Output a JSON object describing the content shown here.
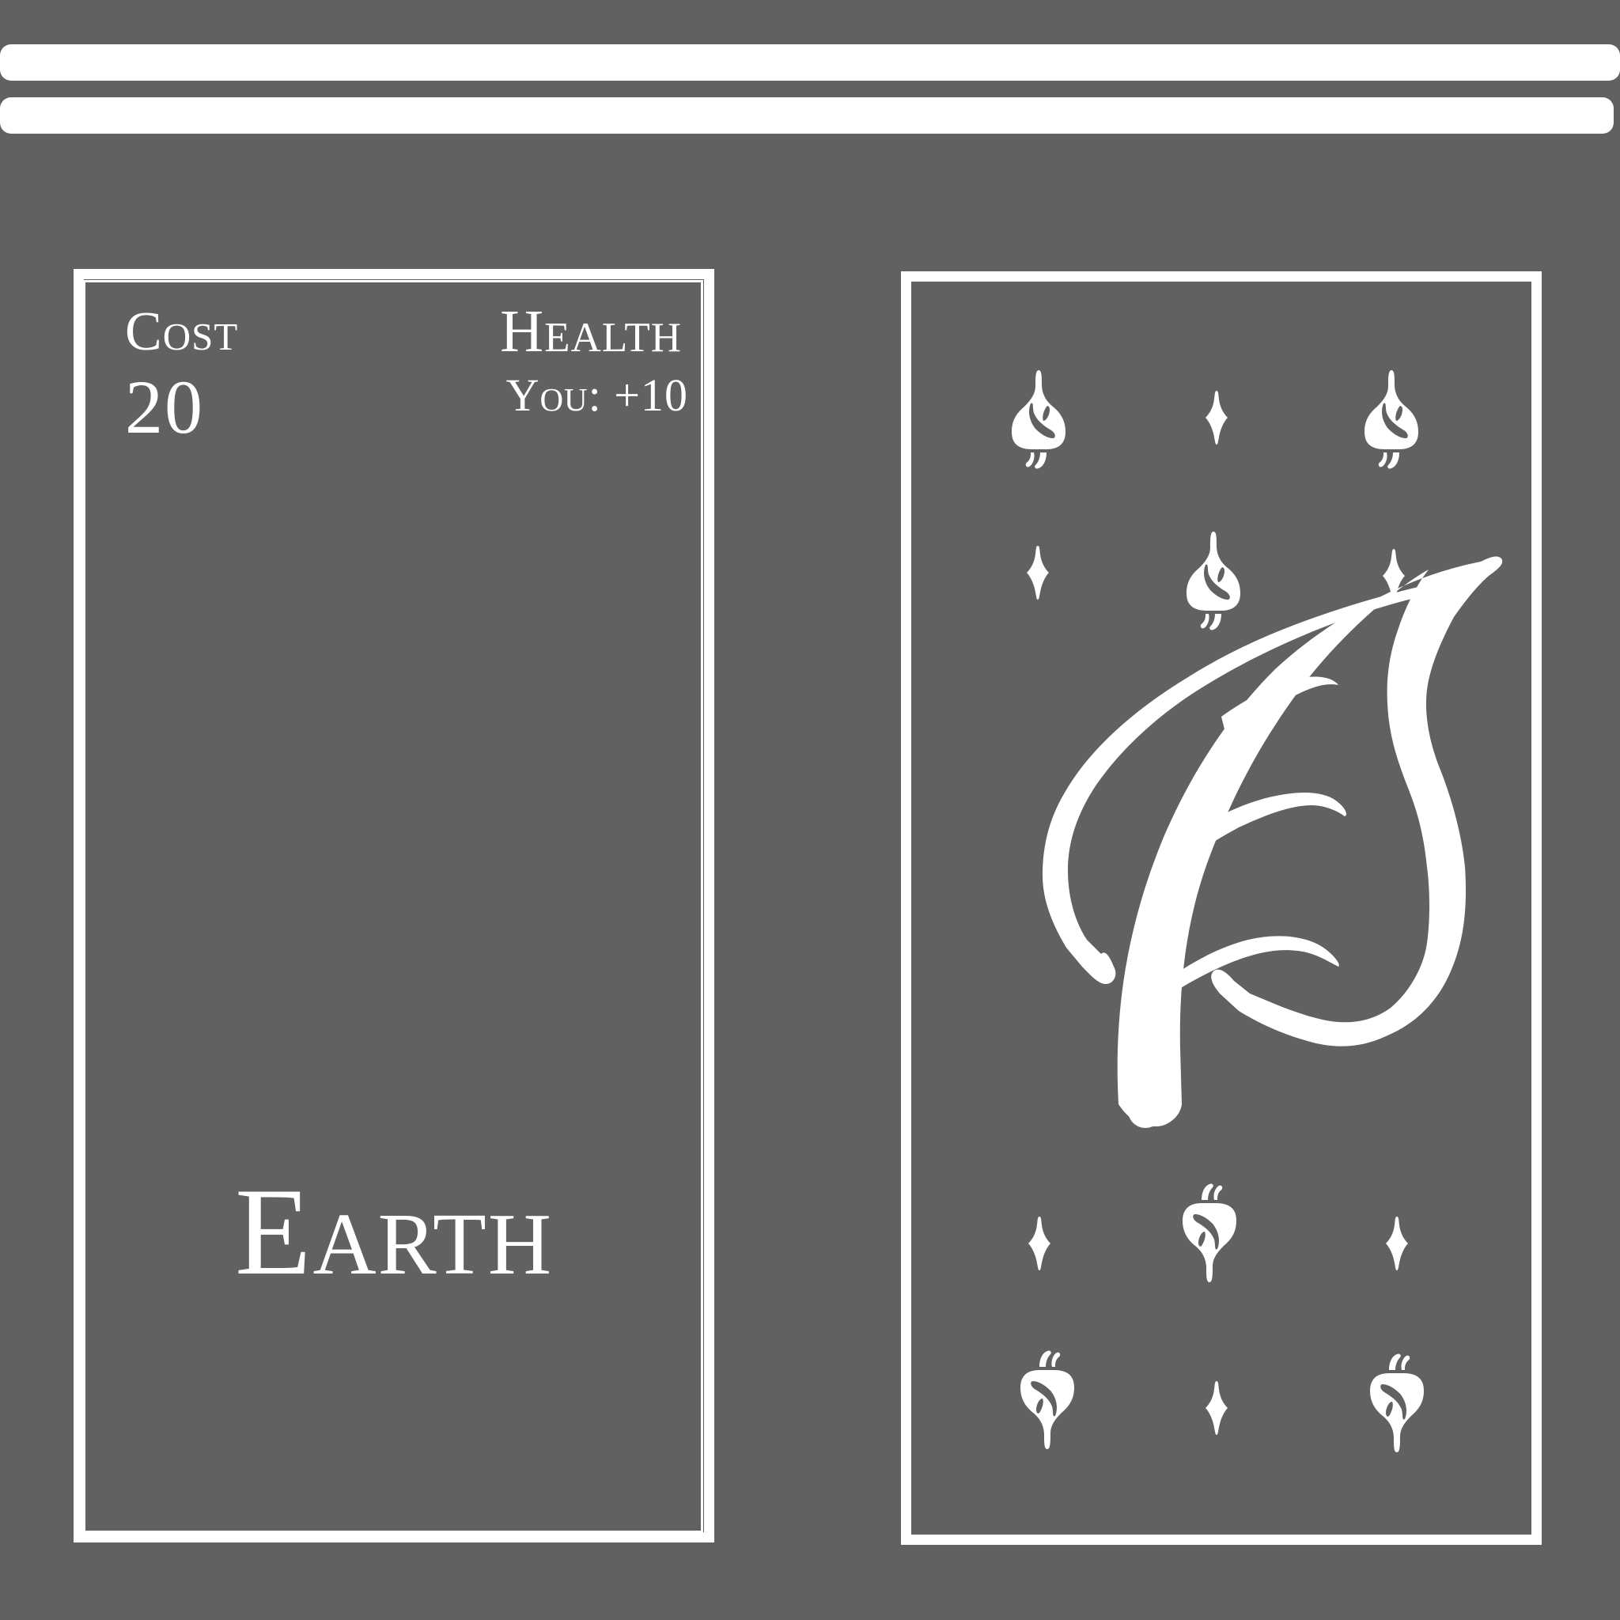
{
  "card": {
    "cost_label": "Cost",
    "cost_value": "20",
    "health_label": "Health",
    "health_value": "You: +10",
    "name": "Earth"
  },
  "art": {
    "main_symbol": "stylized-leaf-icon",
    "pips": [
      "sprout-icon",
      "sparkle-icon",
      "sprout-icon",
      "sparkle-icon",
      "sprout-icon",
      "sparkle-icon",
      "sparkle-icon",
      "sprout-icon",
      "sparkle-icon",
      "sprout-icon",
      "sparkle-icon",
      "sprout-icon"
    ]
  },
  "colors": {
    "background": "#616161",
    "foreground": "#ffffff"
  }
}
